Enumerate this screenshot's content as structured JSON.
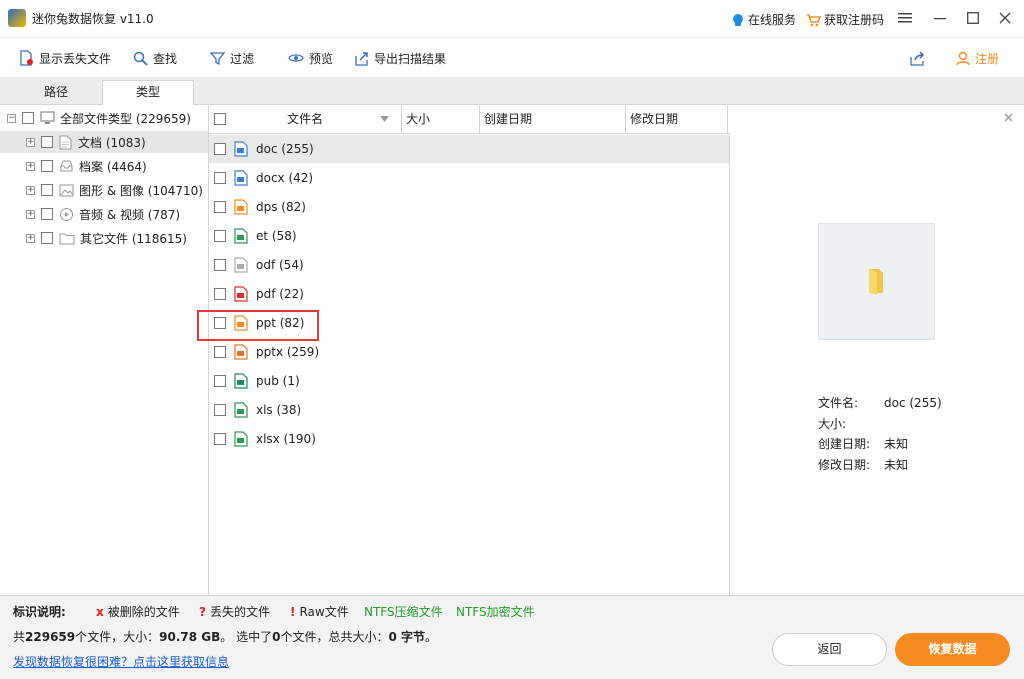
{
  "titlebar": {
    "title": "迷你兔数据恢复 v11.0",
    "online_service": "在线服务",
    "get_code": "获取注册码",
    "online_color": "#1f8ce5",
    "cart_color": "#f68b22"
  },
  "toolbar": {
    "show_lost": "显示丢失文件",
    "find": "查找",
    "filter": "过滤",
    "preview": "预览",
    "export": "导出扫描结果",
    "register": "注册",
    "accent": "#f68b22"
  },
  "tabs": [
    {
      "label": "路径",
      "active": false
    },
    {
      "label": "类型",
      "active": true
    }
  ],
  "tree": {
    "root": "全部文件类型 (229659)",
    "items": [
      {
        "label": "文档 (1083)",
        "icon": "document-icon",
        "selected": true
      },
      {
        "label": "档案 (4464)",
        "icon": "archive-icon",
        "selected": false
      },
      {
        "label": "图形 & 图像 (104710)",
        "icon": "image-icon",
        "selected": false
      },
      {
        "label": "音频 & 视频 (787)",
        "icon": "media-icon",
        "selected": false
      },
      {
        "label": "其它文件 (118615)",
        "icon": "folder-icon",
        "selected": false
      }
    ]
  },
  "columns": {
    "name": "文件名",
    "size": "大小",
    "created": "创建日期",
    "modified": "修改日期"
  },
  "files": [
    {
      "label": "doc (255)",
      "color": "#3b7fd4",
      "selected": true
    },
    {
      "label": "docx (42)",
      "color": "#3b7fd4",
      "selected": false
    },
    {
      "label": "dps (82)",
      "color": "#f68b22",
      "selected": false
    },
    {
      "label": "et (58)",
      "color": "#2e9a4a",
      "selected": false
    },
    {
      "label": "odf (54)",
      "color": "#aaaaaa",
      "selected": false
    },
    {
      "label": "pdf (22)",
      "color": "#d9302c",
      "selected": false
    },
    {
      "label": "ppt (82)",
      "color": "#f68b22",
      "selected": false,
      "highlighted": true
    },
    {
      "label": "pptx (259)",
      "color": "#e8742b",
      "selected": false
    },
    {
      "label": "pub (1)",
      "color": "#1e8a5a",
      "selected": false
    },
    {
      "label": "xls (38)",
      "color": "#2e9a4a",
      "selected": false
    },
    {
      "label": "xlsx (190)",
      "color": "#2e9a4a",
      "selected": false
    }
  ],
  "preview": {
    "filename_label": "文件名:",
    "filename_value": "doc (255)",
    "size_label": "大小:",
    "created_label": "创建日期:",
    "created_value": "未知",
    "modified_label": "修改日期:",
    "modified_value": "未知"
  },
  "legend": {
    "title": "标识说明:",
    "deleted": "被删除的文件",
    "lost": "丢失的文件",
    "raw": "Raw文件",
    "ntfs_compressed": "NTFS压缩文件",
    "ntfs_encrypted": "NTFS加密文件",
    "x_mark": "x",
    "q_mark": "?",
    "bang_mark": "!",
    "red": "#e02020",
    "green": "#22a02a"
  },
  "status": {
    "p1": "共",
    "total_files": "229659",
    "p2": "个文件，大小：",
    "total_size": "90.78 GB",
    "p3": "。 选中了",
    "selected_count": "0",
    "p4": "个文件，总共大小：",
    "selected_size": "0 字节",
    "p5": "。"
  },
  "help_link": "发现数据恢复很困难？点击这里获取信息",
  "buttons": {
    "back": "返回",
    "recover": "恢复数据"
  }
}
